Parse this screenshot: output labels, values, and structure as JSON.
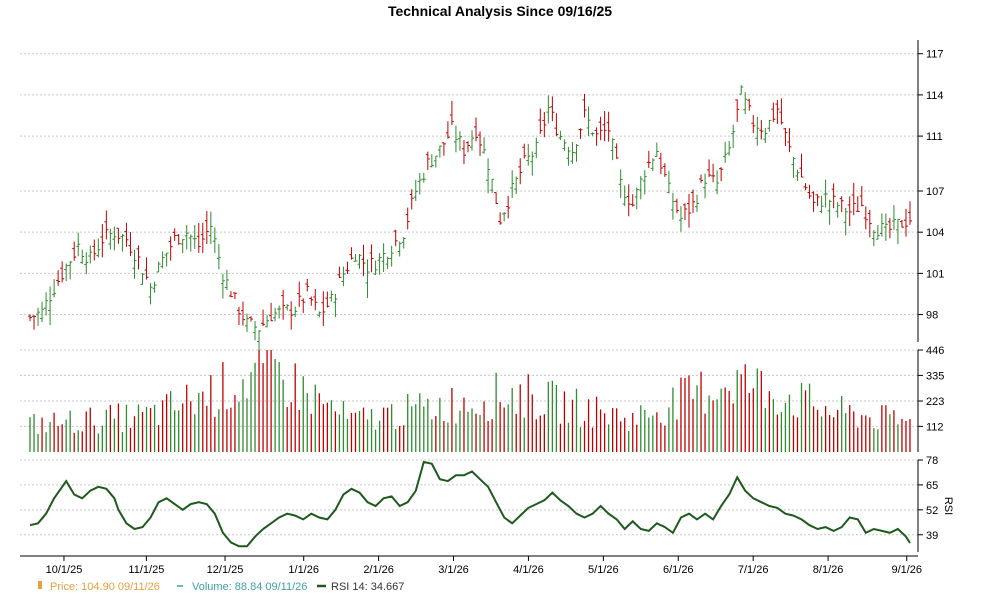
{
  "chart_data": [
    {
      "panel": "price",
      "type": "ohlc",
      "title": "Technical Analysis Since 09/16/25",
      "ylim": [
        96,
        118
      ],
      "yticks": [
        "98",
        "101",
        "104",
        "107",
        "111",
        "114",
        "117"
      ],
      "grid": true,
      "colors": {
        "up": "#2e8b2e",
        "down": "#c00000"
      },
      "anchors": [
        [
          0,
          97.8
        ],
        [
          3,
          98.2
        ],
        [
          6,
          100
        ],
        [
          9,
          101.5
        ],
        [
          12,
          103
        ],
        [
          15,
          102
        ],
        [
          18,
          103.5
        ],
        [
          21,
          104
        ],
        [
          24,
          103.5
        ],
        [
          27,
          102
        ],
        [
          30,
          100
        ],
        [
          33,
          102
        ],
        [
          36,
          103.5
        ],
        [
          39,
          104
        ],
        [
          42,
          103
        ],
        [
          45,
          104.5
        ],
        [
          48,
          101
        ],
        [
          51,
          99
        ],
        [
          54,
          97.3
        ],
        [
          57,
          97
        ],
        [
          60,
          98
        ],
        [
          63,
          98.2
        ],
        [
          66,
          98.5
        ],
        [
          69,
          99.5
        ],
        [
          72,
          98
        ],
        [
          75,
          99
        ],
        [
          78,
          101
        ],
        [
          81,
          102.5
        ],
        [
          84,
          101.5
        ],
        [
          87,
          102
        ],
        [
          90,
          103
        ],
        [
          93,
          104
        ],
        [
          96,
          107
        ],
        [
          99,
          109
        ],
        [
          102,
          110
        ],
        [
          105,
          111.5
        ],
        [
          108,
          110
        ],
        [
          111,
          111.5
        ],
        [
          114,
          109
        ],
        [
          117,
          105
        ],
        [
          120,
          107
        ],
        [
          123,
          109
        ],
        [
          126,
          110
        ],
        [
          129,
          113
        ],
        [
          132,
          111
        ],
        [
          135,
          110
        ],
        [
          138,
          112.5
        ],
        [
          141,
          111
        ],
        [
          144,
          111.5
        ],
        [
          147,
          107.5
        ],
        [
          150,
          106
        ],
        [
          153,
          108.5
        ],
        [
          156,
          110
        ],
        [
          159,
          107
        ],
        [
          162,
          105
        ],
        [
          165,
          106
        ],
        [
          168,
          108
        ],
        [
          171,
          107.5
        ],
        [
          174,
          110
        ],
        [
          177,
          114
        ],
        [
          180,
          112
        ],
        [
          183,
          111.5
        ],
        [
          186,
          113
        ],
        [
          189,
          110
        ],
        [
          192,
          108
        ],
        [
          195,
          106
        ],
        [
          198,
          106.5
        ],
        [
          201,
          106
        ],
        [
          204,
          105.5
        ],
        [
          207,
          106
        ],
        [
          210,
          104.5
        ],
        [
          213,
          104
        ],
        [
          216,
          104.5
        ],
        [
          219,
          105
        ]
      ]
    },
    {
      "panel": "volume",
      "type": "bar",
      "ylim": [
        0,
        446
      ],
      "yticks": [
        "112",
        "223",
        "335",
        "446"
      ],
      "anchors": [
        [
          0,
          150
        ],
        [
          30,
          200
        ],
        [
          60,
          446
        ],
        [
          80,
          170
        ],
        [
          120,
          320
        ],
        [
          150,
          180
        ],
        [
          175,
          400
        ],
        [
          200,
          220
        ],
        [
          219,
          160
        ]
      ]
    },
    {
      "panel": "rsi",
      "type": "line",
      "ylabel": "RSI",
      "ylim": [
        30,
        78
      ],
      "yticks": [
        "39",
        "52",
        "65",
        "78"
      ],
      "colors": {
        "line": "#1e5a1e"
      },
      "values": [
        [
          0,
          44
        ],
        [
          2,
          45
        ],
        [
          4,
          50
        ],
        [
          6,
          58
        ],
        [
          8,
          64
        ],
        [
          9,
          67
        ],
        [
          11,
          60
        ],
        [
          13,
          58
        ],
        [
          15,
          62
        ],
        [
          17,
          64
        ],
        [
          19,
          63
        ],
        [
          21,
          58
        ],
        [
          22,
          52
        ],
        [
          24,
          45
        ],
        [
          26,
          42
        ],
        [
          28,
          43
        ],
        [
          30,
          48
        ],
        [
          32,
          56
        ],
        [
          34,
          58
        ],
        [
          36,
          55
        ],
        [
          38,
          52
        ],
        [
          40,
          55
        ],
        [
          42,
          56
        ],
        [
          44,
          55
        ],
        [
          46,
          50
        ],
        [
          48,
          40
        ],
        [
          50,
          35
        ],
        [
          52,
          33
        ],
        [
          54,
          33
        ],
        [
          56,
          38
        ],
        [
          58,
          42
        ],
        [
          60,
          45
        ],
        [
          62,
          48
        ],
        [
          64,
          50
        ],
        [
          66,
          49
        ],
        [
          68,
          47
        ],
        [
          70,
          50
        ],
        [
          72,
          48
        ],
        [
          74,
          47
        ],
        [
          76,
          52
        ],
        [
          78,
          60
        ],
        [
          80,
          63
        ],
        [
          82,
          61
        ],
        [
          84,
          56
        ],
        [
          86,
          54
        ],
        [
          88,
          58
        ],
        [
          90,
          59
        ],
        [
          92,
          54
        ],
        [
          94,
          56
        ],
        [
          96,
          62
        ],
        [
          98,
          77
        ],
        [
          100,
          76
        ],
        [
          102,
          68
        ],
        [
          104,
          67
        ],
        [
          106,
          70
        ],
        [
          108,
          70
        ],
        [
          110,
          72
        ],
        [
          112,
          68
        ],
        [
          114,
          64
        ],
        [
          116,
          56
        ],
        [
          118,
          48
        ],
        [
          120,
          45
        ],
        [
          122,
          49
        ],
        [
          124,
          53
        ],
        [
          126,
          55
        ],
        [
          128,
          57
        ],
        [
          130,
          61
        ],
        [
          132,
          57
        ],
        [
          134,
          54
        ],
        [
          136,
          50
        ],
        [
          138,
          48
        ],
        [
          140,
          50
        ],
        [
          142,
          54
        ],
        [
          144,
          50
        ],
        [
          146,
          47
        ],
        [
          148,
          42
        ],
        [
          150,
          46
        ],
        [
          152,
          42
        ],
        [
          154,
          41
        ],
        [
          156,
          45
        ],
        [
          158,
          43
        ],
        [
          160,
          40
        ],
        [
          162,
          48
        ],
        [
          164,
          50
        ],
        [
          166,
          47
        ],
        [
          168,
          50
        ],
        [
          170,
          47
        ],
        [
          172,
          54
        ],
        [
          174,
          60
        ],
        [
          176,
          69
        ],
        [
          178,
          62
        ],
        [
          180,
          58
        ],
        [
          182,
          56
        ],
        [
          184,
          54
        ],
        [
          186,
          53
        ],
        [
          188,
          50
        ],
        [
          190,
          49
        ],
        [
          192,
          47
        ],
        [
          194,
          44
        ],
        [
          196,
          42
        ],
        [
          198,
          43
        ],
        [
          200,
          41
        ],
        [
          202,
          43
        ],
        [
          204,
          48
        ],
        [
          206,
          47
        ],
        [
          208,
          40
        ],
        [
          210,
          42
        ],
        [
          212,
          41
        ],
        [
          214,
          40
        ],
        [
          216,
          42
        ],
        [
          218,
          38
        ],
        [
          219,
          34.7
        ]
      ]
    }
  ],
  "x_axis": {
    "labels": [
      "10/1/25",
      "11/1/25",
      "12/1/25",
      "1/1/26",
      "2/1/26",
      "3/1/26",
      "4/1/26",
      "5/1/26",
      "6/1/26",
      "7/1/26",
      "8/1/26",
      "9/1/26"
    ],
    "label_index": [
      8,
      30,
      51,
      72,
      92,
      112,
      132,
      152,
      172,
      192,
      212,
      233
    ]
  },
  "legend": {
    "price": {
      "label": "Price: 104.90  09/11/26",
      "color": "#e8a040"
    },
    "volume": {
      "label": "Volume: 88.84  09/11/26",
      "color": "#40a0a0"
    },
    "rsi": {
      "label": "RSI 14: 34.667",
      "color": "#1e5a1e"
    }
  }
}
